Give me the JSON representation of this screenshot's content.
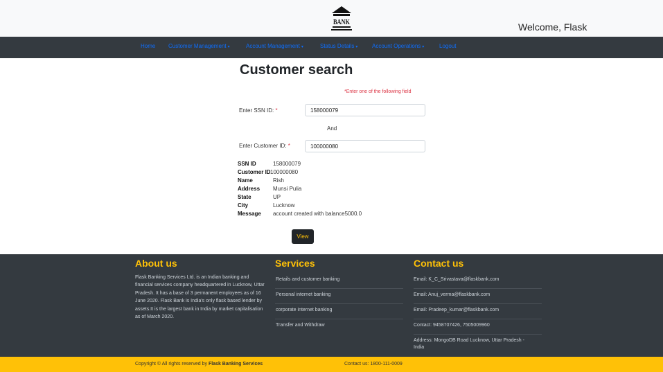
{
  "header": {
    "logo_text": "BANK",
    "welcome": "Welcome, Flask"
  },
  "nav": {
    "home": "Home",
    "customer_management": "Customer Management",
    "account_management": "Account Management",
    "status_details": "Status Details",
    "account_operations": "Account Operations",
    "logout": "Logout",
    "dropdown_caret": "▾"
  },
  "form": {
    "title": "Customer search",
    "note": "*Enter one of the following field",
    "ssn_label": "Enter SSN ID:",
    "ssn_value": "158000079",
    "and_text": "And",
    "customer_label": "Enter Customer ID:",
    "customer_value": "100000080",
    "required_mark": "*"
  },
  "details": {
    "ssn_id_label": "SSN ID",
    "ssn_id": "158000079",
    "customer_id_label": "Customer ID",
    "customer_id": "100000080",
    "name_label": "Name",
    "name": "Rish",
    "address_label": "Address",
    "address": "Munsi Pulia",
    "state_label": "State",
    "state": "UP",
    "city_label": "City",
    "city": "Lucknow",
    "message_label": "Message",
    "message": "account created with balance5000.0"
  },
  "view_button": "View",
  "footer": {
    "about_heading": "About us",
    "about_text": "Flask Banking Services Ltd. is an Indian banking and financial services company headquartered in Lucknow, Uttar Pradesh. It has a base of 3 permanent employees as of 16 June 2020. Flask Bank is India's only flask based lender by assets.It is the largest bank in India by market capitalisation as of March 2020.",
    "services_heading": "Services",
    "services": [
      "Retails and customer banking",
      "Personal internet banking",
      "corporate internet banking",
      "Transfer and Withdraw"
    ],
    "contact_heading": "Contact us",
    "contact": [
      "Email: K_C_Srivastava@flaskbank.com",
      "Email: Anuj_verma@flaskbank.com",
      "Email: Pradeep_kumar@flaskbank.com",
      "Contact: 9458707426, 7505009960",
      "Address: MongoDB Road Lucknow, Uttar Pradesh - India"
    ]
  },
  "copyright": {
    "prefix": "Copyright © All rights reserved by",
    "company": "Flask Banking Services",
    "contact": "Contact us: 1800-111-0009"
  }
}
